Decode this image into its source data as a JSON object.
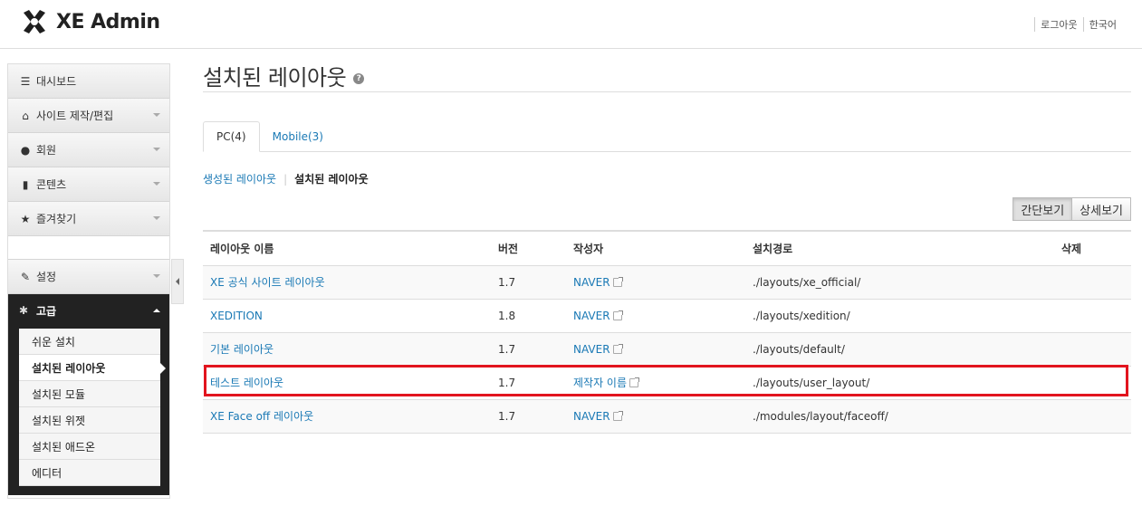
{
  "header": {
    "app_name": "XE Admin",
    "logout": "로그아웃",
    "language": "한국어"
  },
  "sidebar": {
    "items": [
      {
        "icon": "list-icon",
        "label": "대시보드"
      },
      {
        "icon": "home-icon",
        "label": "사이트 제작/편집"
      },
      {
        "icon": "user-icon",
        "label": "회원"
      },
      {
        "icon": "book-icon",
        "label": "콘텐츠"
      },
      {
        "icon": "star-icon",
        "label": "즐겨찾기"
      }
    ],
    "settings": {
      "icon": "wrench-icon",
      "label": "설정"
    },
    "advanced": {
      "icon": "gear-icon",
      "label": "고급"
    },
    "sub_items": [
      {
        "label": "쉬운 설치"
      },
      {
        "label": "설치된 레이아웃"
      },
      {
        "label": "설치된 모듈"
      },
      {
        "label": "설치된 위젯"
      },
      {
        "label": "설치된 애드온"
      },
      {
        "label": "에디터"
      }
    ]
  },
  "main": {
    "title": "설치된 레이아웃",
    "tabs": [
      {
        "label": "PC(4)"
      },
      {
        "label": "Mobile(3)"
      }
    ],
    "subnav": {
      "generated": "생성된 레이아웃",
      "installed": "설치된 레이아웃"
    },
    "view_toggle": {
      "simple": "간단보기",
      "detail": "상세보기"
    },
    "table": {
      "headers": [
        "레이아웃 이름",
        "버전",
        "작성자",
        "설치경로",
        "삭제"
      ],
      "rows": [
        {
          "name": "XE 공식 사이트 레이아웃",
          "version": "1.7",
          "author": "NAVER",
          "path": "./layouts/xe_official/"
        },
        {
          "name": "XEDITION",
          "version": "1.8",
          "author": "NAVER",
          "path": "./layouts/xedition/"
        },
        {
          "name": "기본 레이아웃",
          "version": "1.7",
          "author": "NAVER",
          "path": "./layouts/default/"
        },
        {
          "name": "테스트 레이아웃",
          "version": "1.7",
          "author": "제작자 이름",
          "path": "./layouts/user_layout/"
        },
        {
          "name": "XE Face off 레이아웃",
          "version": "1.7",
          "author": "NAVER",
          "path": "./modules/layout/faceoff/"
        }
      ]
    }
  },
  "colors": {
    "link": "#1a79b5",
    "highlight": "#e2141e",
    "sidebar_active": "#222222"
  }
}
